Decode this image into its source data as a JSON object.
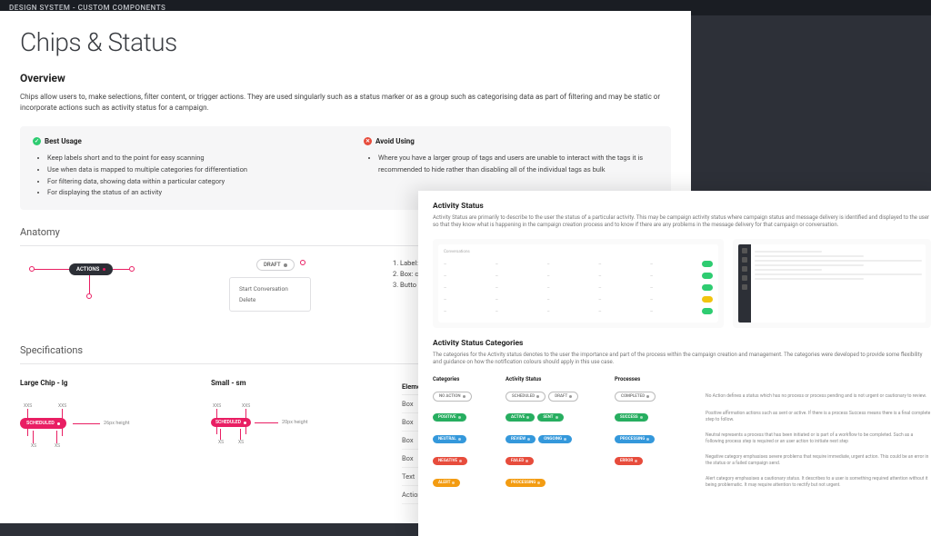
{
  "top_bar": "DESIGN SYSTEM - CUSTOM COMPONENTS",
  "page_title": "Chips & Status",
  "overview": {
    "heading": "Overview",
    "text": "Chips allow users to, make selections, filter content, or trigger actions. They are used singularly such as a status marker or as a group such as categorising data as part of filtering and may be static or incorporate actions such as activity status for a campaign."
  },
  "usage": {
    "best_title": "Best Usage",
    "avoid_title": "Avoid Using",
    "best_items": [
      "Keep labels short and to the point for easy scanning",
      "Use when data is mapped to multiple categories for differentiation",
      "For filtering data, showing data within a particular category",
      "For displaying the status of an activity"
    ],
    "avoid_items": [
      "Where you have a larger group of tags and users are unable to interact with the tags it is recommended to hide rather than disabling all of the individual tags as bulk"
    ]
  },
  "anatomy": {
    "heading": "Anatomy",
    "chip_actions": "ACTIONS",
    "chip_draft": "DRAFT",
    "menu_item_1": "Start Conversation",
    "menu_item_2": "Delete",
    "labels": {
      "l1": "1. Label:",
      "l2": "2. Box: c",
      "l3": "3. Butto"
    }
  },
  "specs": {
    "heading": "Specifications",
    "large_label": "Large Chip - lg",
    "small_label": "Small - sm",
    "chip_scheduled": "SCHEDULED",
    "dim_xxs": "XXS",
    "dim_xs": "XS",
    "note_26": "26px height",
    "note_20": "20px height",
    "table_head": "Element",
    "table_rows": [
      "Box",
      "Box",
      "Box",
      "Box",
      "Text",
      "Actions"
    ]
  },
  "overlay": {
    "status_heading": "Activity Status",
    "status_desc": "Activity Status are primarily to describe to the user the status of a particular activity. This may be campaign activity status where campaign status and message delivery is identified and displayed to the user so that they know what is happening in the campaign creation process and to know if there are any problems in the message delivery for that campaign or conversation.",
    "preview_a_title": "Conversations",
    "cat_heading": "Activity Status Categories",
    "cat_desc": "The categories for the Activity status denotes to the user the importance and part of the process within the campaign creation and management. The categories were developed to provide some flexibility and guidance on how the notification colours should apply in this use case.",
    "cat_head": {
      "c1": "Categories",
      "c2": "Activity Status",
      "c3": "Processes",
      "c4": ""
    },
    "rows": [
      {
        "cat": "NO ACTION",
        "cat_style": "pill-outline",
        "status": [
          "SCHEDULED",
          "DRAFT"
        ],
        "status_style": "pill-outline",
        "proc": "COMPLETED",
        "proc_style": "pill-outline",
        "desc": "No Action defines a status which has no process or process pending and is not urgent or cautionary to review."
      },
      {
        "cat": "POSITIVE",
        "cat_style": "pill-green2",
        "status": [
          "ACTIVE",
          "SENT"
        ],
        "status_style": "pill-green2",
        "proc": "SUCCESS",
        "proc_style": "pill-green2",
        "desc": "Positive affirmation actions such as sent or active. If there is a process Success means there is a final complete step to follow."
      },
      {
        "cat": "NEUTRAL",
        "cat_style": "pill-blue",
        "status": [
          "REVIEW",
          "ONGOING"
        ],
        "status_style": "pill-blue",
        "proc": "PROCESSING",
        "proc_style": "pill-blue",
        "desc": "Neutral represents a process that has been initiated or is part of a workflow to be completed. Such as a following process step is required or an user action to initiate next step"
      },
      {
        "cat": "NEGATIVE",
        "cat_style": "pill-red",
        "status": [
          "FAILED"
        ],
        "status_style": "pill-red",
        "proc": "ERROR",
        "proc_style": "pill-red",
        "desc": "Negative category emphasises severe problems that require immediate, urgent action. This could be an error in the status or a failed campaign send."
      },
      {
        "cat": "ALERT",
        "cat_style": "pill-amber",
        "status": [
          "PROCESSING"
        ],
        "status_style": "pill-amber",
        "proc": "",
        "proc_style": "pill-amber",
        "desc": "Alert category emphasises a cautionary status. It describes to a user is something required attention without it being problematic. It may require attention to rectify but not urgent."
      }
    ]
  }
}
